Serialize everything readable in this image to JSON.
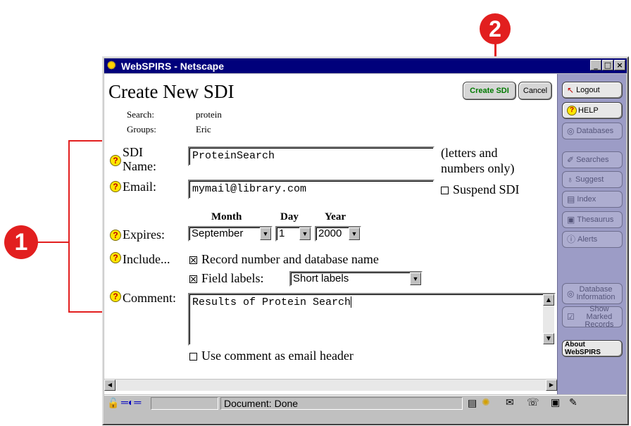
{
  "callouts": [
    "1",
    "2"
  ],
  "window": {
    "title": "WebSPIRS - Netscape",
    "controls": [
      "_",
      "□",
      "×"
    ]
  },
  "form": {
    "page_title": "Create New SDI",
    "create_button": "Create SDI",
    "cancel_button": "Cancel",
    "search_label": "Search:",
    "search_value": "protein",
    "groups_label": "Groups:",
    "groups_value": "Eric",
    "sdi_name_label_1": "SDI",
    "sdi_name_label_2": "Name:",
    "sdi_name_value": "ProteinSearch",
    "sdi_name_note_1": "(letters and",
    "sdi_name_note_2": "numbers only)",
    "email_label": "Email:",
    "email_value": "mymail@library.com",
    "suspend_label": "Suspend SDI",
    "suspend_checked": false,
    "month_header": "Month",
    "day_header": "Day",
    "year_header": "Year",
    "expires_label": "Expires:",
    "month_value": "September",
    "day_value": "1",
    "year_value": "2000",
    "include_label": "Include...",
    "record_number_label": "Record number and database name",
    "record_number_checked": true,
    "field_labels_label": "Field labels:",
    "field_labels_checked": true,
    "field_labels_value": "Short labels",
    "comment_label": "Comment:",
    "comment_value": "Results of Protein Search",
    "use_comment_label": "Use comment as email header",
    "use_comment_checked": false
  },
  "nav": {
    "logout": "Logout",
    "help": "HELP",
    "databases": "Databases",
    "searches": "Searches",
    "suggest": "Suggest",
    "index": "Index",
    "thesaurus": "Thesaurus",
    "alerts": "Alerts",
    "database_information_1": "Database",
    "database_information_2": "Information",
    "show_marked_records_1": "Show Marked",
    "show_marked_records_2": "Records",
    "about": "About WebSPIRS"
  },
  "status": {
    "text": "Document: Done"
  },
  "colors": {
    "titlebar": "#00007b",
    "callout": "#e21f1f",
    "nav_panel": "#9c9cc6",
    "help_icon": "#ffe600",
    "create_button_text": "#007a00"
  }
}
